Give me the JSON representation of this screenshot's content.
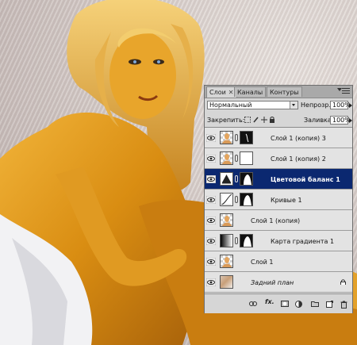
{
  "panel": {
    "tabs": [
      {
        "label": "Слои",
        "active": true,
        "close": "✕"
      },
      {
        "label": "Каналы",
        "active": false
      },
      {
        "label": "Контуры",
        "active": false
      }
    ],
    "blend_mode": "Нормальный",
    "opacity_label": "Непрозр.:",
    "opacity_value": "100%",
    "lock_label": "Закрепить:",
    "fill_label": "Заливка:",
    "fill_value": "100%",
    "layers": [
      {
        "name": "Слой 1 (копия) 3",
        "thumb": "photo",
        "mask": "dark-mask",
        "selected": false
      },
      {
        "name": "Слой 1 (копия) 2",
        "thumb": "photo",
        "mask": "white",
        "selected": false
      },
      {
        "name": "Цветовой баланс 1",
        "thumb": "balance-icon",
        "mask": "silhouette",
        "selected": true
      },
      {
        "name": "Кривые 1",
        "thumb": "curves-icon",
        "mask": "silhouette",
        "selected": false
      },
      {
        "name": "Слой 1 (копия)",
        "thumb": "photo",
        "mask": null,
        "selected": false
      },
      {
        "name": "Карта градиента 1",
        "thumb": "gradient-icon",
        "mask": "silhouette",
        "selected": false
      },
      {
        "name": "Слой 1",
        "thumb": "photo",
        "mask": null,
        "selected": false
      },
      {
        "name": "Задний план",
        "thumb": "photo-color",
        "mask": null,
        "selected": false,
        "italic": true,
        "locked": true
      }
    ],
    "bottom_icons": [
      "link-icon",
      "fx-icon",
      "mask-icon",
      "adjustment-icon",
      "group-icon",
      "new-layer-icon",
      "trash-icon"
    ],
    "fx_label": "fx."
  }
}
